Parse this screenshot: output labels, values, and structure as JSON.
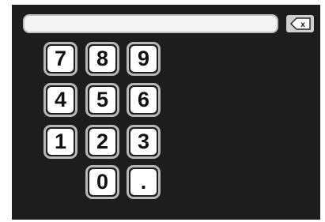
{
  "entry": {
    "value": ""
  },
  "backspace": {
    "label": "x"
  },
  "keys": {
    "k7": "7",
    "k8": "8",
    "k9": "9",
    "k4": "4",
    "k5": "5",
    "k6": "6",
    "k1": "1",
    "k2": "2",
    "k3": "3",
    "k0": "0",
    "dot": "."
  },
  "colors": {
    "panel_bg": "#1d1d1d",
    "key_face": "#ffffff",
    "key_border": "#b8b8b8",
    "entry_bg": "#f4f4f4"
  }
}
